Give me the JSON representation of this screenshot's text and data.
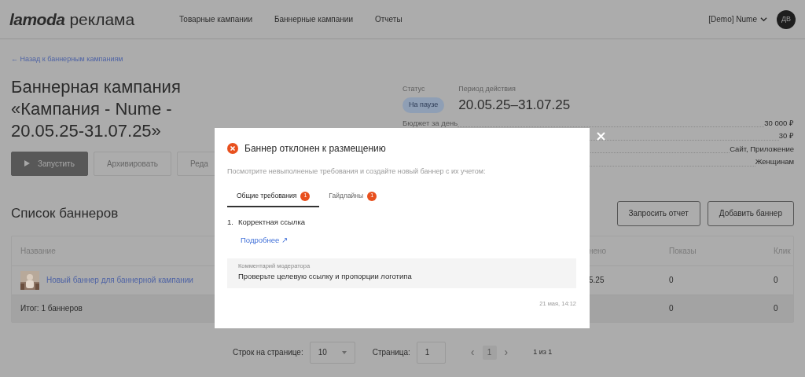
{
  "header": {
    "logo_brand": "lamoda",
    "logo_product": "реклама",
    "nav": [
      {
        "label": "Товарные кампании"
      },
      {
        "label": "Баннерные кампании"
      },
      {
        "label": "Отчеты"
      }
    ],
    "account": "[Demo] Nume",
    "avatar": "ДВ"
  },
  "back_link": "← Назад к баннерным кампаниям",
  "title_lines": [
    "Баннерная кампания",
    "«Кампания - Nume -",
    "20.05.25-31.07.25»"
  ],
  "actions": [
    {
      "label": "Запустить",
      "kind": "primary",
      "disabled": false
    },
    {
      "label": "Архивировать",
      "kind": "outline",
      "disabled": true
    },
    {
      "label": "Реда",
      "kind": "outline",
      "disabled": true
    }
  ],
  "status": {
    "label": "Статус",
    "value": "На паузе"
  },
  "period": {
    "label": "Период действия",
    "value": "20.05.25–31.07.25"
  },
  "details": [
    {
      "label": "Бюджет за день",
      "value": "30 000 ₽"
    },
    {
      "value": "30 ₽"
    },
    {
      "value": "Сайт, Приложение"
    },
    {
      "value": "Женщинам"
    }
  ],
  "banners": {
    "title": "Список баннеров",
    "buttons": [
      "Запросить отчет",
      "Добавить баннер"
    ]
  },
  "table": {
    "columns": [
      "Название",
      "нено",
      "Показы",
      "Клик"
    ],
    "rows": [
      {
        "name": "Новый баннер для баннерной кампании",
        "column_2": "5.25",
        "impressions": "0",
        "clicks": "0"
      }
    ],
    "total": {
      "label": "Итог: 1 баннеров",
      "impressions": "0",
      "clicks": "0"
    }
  },
  "pagination": {
    "rows_label": "Строк на странице:",
    "rows_value": "10",
    "page_label": "Страница:",
    "page_value": "1",
    "prev": "‹",
    "current": "1",
    "next": "›",
    "summary": "1 из 1"
  },
  "modal": {
    "title": "Баннер отклонен к размещению",
    "subtitle": "Посмотрите невыполненые требования и создайте новый баннер с их учетом:",
    "tabs": [
      {
        "label": "Общие требования",
        "badge": "1",
        "selected": true
      },
      {
        "label": "Гайдлайны",
        "badge": "1",
        "selected": false
      }
    ],
    "requirements": [
      {
        "number": "1.",
        "text": "Корректная ссылка",
        "link": "Подробнее ↗"
      }
    ],
    "comment": {
      "label": "Комментарий модератора",
      "text": "Проверьте целевую ссылку и пропорции логотипа"
    },
    "timestamp": "21 мая, 14:12"
  }
}
